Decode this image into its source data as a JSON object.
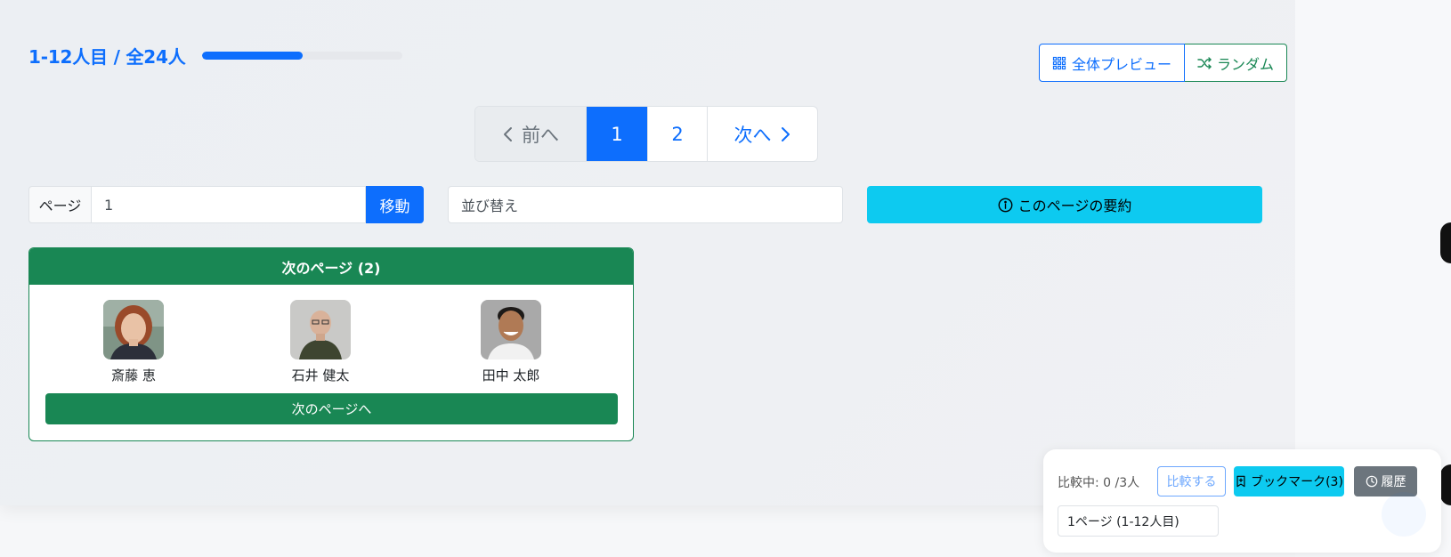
{
  "header": {
    "count_text": "1-12人目 / 全24人",
    "progress_fraction": 0.5,
    "preview_label": "全体プレビュー",
    "preview_icon": "grid-icon",
    "random_label": "ランダム",
    "random_icon": "shuffle-icon"
  },
  "pagination": {
    "prev_label": "前へ",
    "pages": [
      "1",
      "2"
    ],
    "current_page": "1",
    "next_label": "次へ"
  },
  "controls": {
    "page_label": "ページ",
    "page_input_value": "1",
    "go_label": "移動",
    "sort_label": "並び替え",
    "summary_label": "このページの要約",
    "summary_icon": "info-icon"
  },
  "next_card": {
    "title": "次のページ (2)",
    "people": [
      {
        "name": "斎藤 恵",
        "avatar": "photo-woman-red-hair"
      },
      {
        "name": "石井 健太",
        "avatar": "photo-man-bald-glasses"
      },
      {
        "name": "田中 太郎",
        "avatar": "photo-man-smiling"
      }
    ],
    "button_label": "次のページへ"
  },
  "compare_panel": {
    "status": "比較中: 0 /3人",
    "compare_label": "比較する",
    "bookmark_label": "ブックマーク(3)",
    "history_label": "履歴",
    "page_select_value": "1ページ (1-12人目)"
  },
  "colors": {
    "primary": "#0d6efd",
    "success": "#198754",
    "info": "#0dcaf0",
    "secondary": "#6c757d"
  }
}
